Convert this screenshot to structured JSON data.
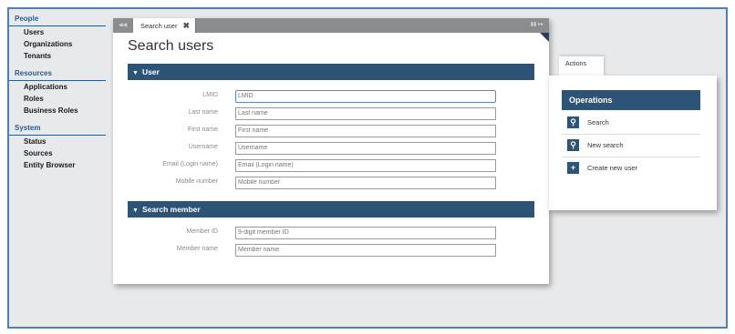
{
  "sidebar": {
    "groups": [
      {
        "header": "People",
        "items": [
          "Users",
          "Organizations",
          "Tenants"
        ]
      },
      {
        "header": "Resources",
        "items": [
          "Applications",
          "Roles",
          "Business Roles"
        ]
      },
      {
        "header": "System",
        "items": [
          "Status",
          "Sources",
          "Entity Browser"
        ]
      }
    ]
  },
  "window": {
    "tab_label": "Search user",
    "tab_close": "✖",
    "title": "Search users"
  },
  "user_section": {
    "header": "User",
    "fields": [
      {
        "label": "LMID",
        "placeholder": "LMID"
      },
      {
        "label": "Last name",
        "placeholder": "Last name"
      },
      {
        "label": "First name",
        "placeholder": "First name"
      },
      {
        "label": "Username",
        "placeholder": "Username"
      },
      {
        "label": "Email (Login name)",
        "placeholder": "Email (Login name)"
      },
      {
        "label": "Mobile number",
        "placeholder": "Mobile number"
      }
    ]
  },
  "member_section": {
    "header": "Search member",
    "fields": [
      {
        "label": "Member ID",
        "placeholder": "9-digit member ID"
      },
      {
        "label": "Member name",
        "placeholder": "Member name"
      }
    ]
  },
  "actions": {
    "tab_label": "Actions",
    "operations_header": "Operations",
    "items": [
      {
        "label": "Search",
        "icon": "search-icon"
      },
      {
        "label": "New search",
        "icon": "new-search-icon"
      },
      {
        "label": "Create new user",
        "icon": "plus-icon"
      }
    ]
  },
  "colors": {
    "accent": "#2d5377",
    "frame_border": "#4f7fb9",
    "sidebar_header": "#2d5b8c"
  }
}
